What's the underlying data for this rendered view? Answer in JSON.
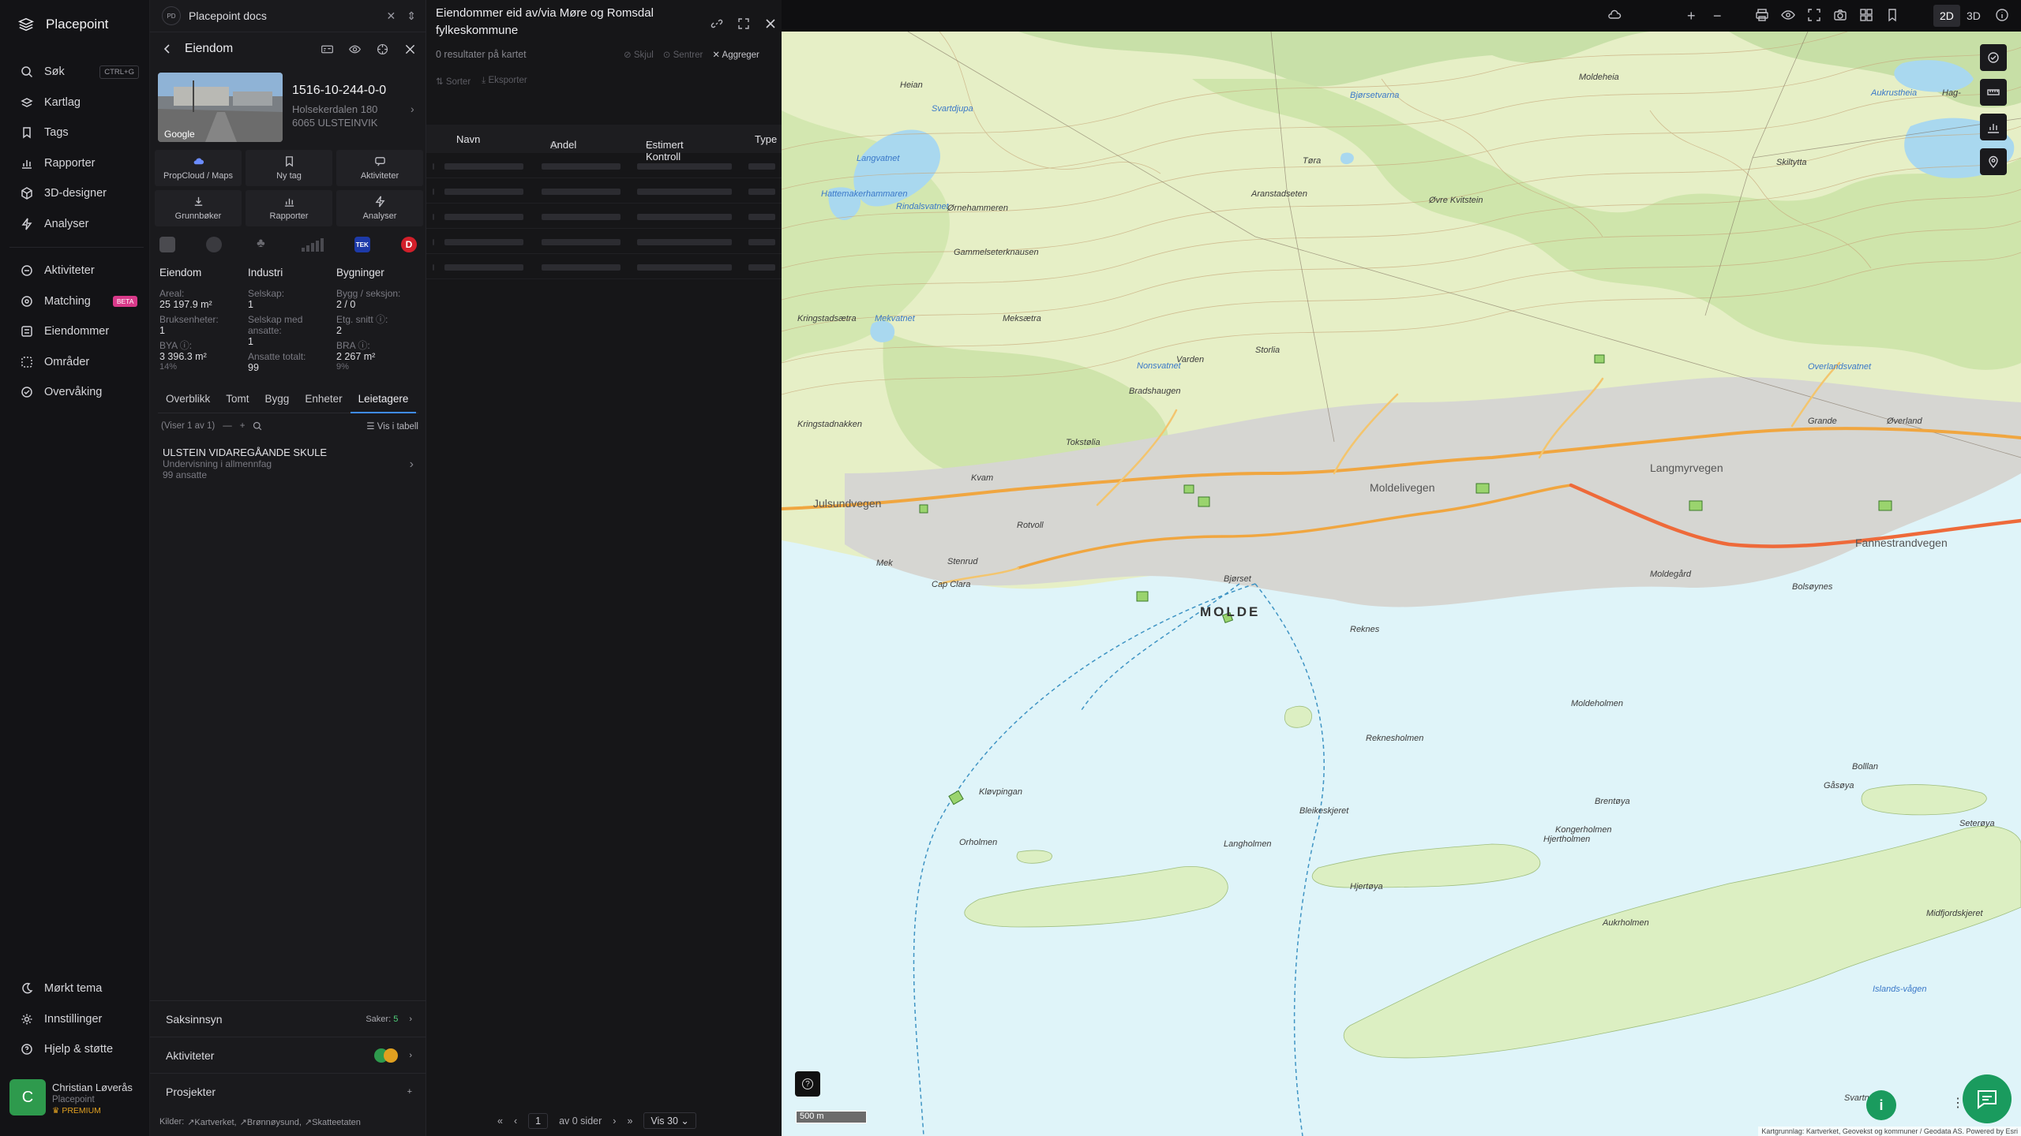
{
  "nav": {
    "brand": "Placepoint",
    "items": [
      {
        "label": "Søk",
        "icon": "search-icon",
        "kbd": "CTRL+G"
      },
      {
        "label": "Kartlag",
        "icon": "layers-icon"
      },
      {
        "label": "Tags",
        "icon": "bookmark-icon"
      },
      {
        "label": "Rapporter",
        "icon": "bar-chart-icon"
      },
      {
        "label": "3D-designer",
        "icon": "cube-icon"
      },
      {
        "label": "Analyser",
        "icon": "bolt-icon"
      }
    ],
    "items2": [
      {
        "label": "Aktiviteter",
        "icon": "chat-icon"
      },
      {
        "label": "Matching",
        "icon": "target-icon",
        "badge": "BETA"
      },
      {
        "label": "Eiendommer",
        "icon": "list-icon"
      },
      {
        "label": "Områder",
        "icon": "dashed-square-icon"
      },
      {
        "label": "Overvåking",
        "icon": "check-circle-icon"
      }
    ],
    "bottom": [
      {
        "label": "Mørkt tema",
        "icon": "moon-icon"
      },
      {
        "label": "Innstillinger",
        "icon": "gear-icon"
      },
      {
        "label": "Hjelp & støtte",
        "icon": "help-icon"
      }
    ],
    "user": {
      "initial": "C",
      "name": "Christian Løverås",
      "org": "Placepoint",
      "tier": "PREMIUM"
    }
  },
  "doc": {
    "badge": "PD",
    "title": "Placepoint docs"
  },
  "entity": {
    "title": "Eiendom",
    "photo_label": "Google",
    "id": "1516-10-244-0-0",
    "address1": "Holsekerdalen 180",
    "address2": "6065 ULSTEINVIK"
  },
  "actions": [
    "PropCloud / Maps",
    "Ny tag",
    "Aktiviteter",
    "Grunnbøker",
    "Rapporter",
    "Analyser"
  ],
  "sources": {
    "tek_label": "TEK",
    "d_label": "D"
  },
  "stats": {
    "eiendom": {
      "header": "Eiendom",
      "areal_label": "Areal:",
      "areal": "25 197.9 m²",
      "bruks_label": "Bruksenheter:",
      "bruks": "1",
      "bya_label": "BYA ⓘ:",
      "bya": "3 396.3 m²",
      "bya_pct": "14%"
    },
    "industri": {
      "header": "Industri",
      "selskap_label": "Selskap:",
      "selskap": "1",
      "ansatte_label": "Selskap med ansatte:",
      "ansatte": "1",
      "total_label": "Ansatte totalt:",
      "total": "99"
    },
    "bygninger": {
      "header": "Bygninger",
      "bygg_label": "Bygg / seksjon:",
      "bygg": "2 / 0",
      "etg_label": "Etg. snitt ⓘ:",
      "etg": "2",
      "bra_label": "BRA ⓘ:",
      "bra": "2 267 m²",
      "bra_pct": "9%"
    }
  },
  "tabs": [
    "Overblikk",
    "Tomt",
    "Bygg",
    "Enheter",
    "Leietagere"
  ],
  "subbar": {
    "showing": "(Viser 1 av 1)",
    "table": "Vis i tabell"
  },
  "tenant": {
    "name": "ULSTEIN VIDAREGÅANDE SKULE",
    "category": "Undervisning i allmennfag",
    "employees": "99 ansatte"
  },
  "accordions": {
    "saksinnsyn": "Saksinnsyn",
    "saker_label": "Saker:",
    "saker_count": "5",
    "aktiviteter": "Aktiviteter",
    "prosjekter": "Prosjekter"
  },
  "kilder": {
    "label": "Kilder:",
    "items": [
      "Kartverket,",
      "Brønnøysund,",
      "Skatteetaten"
    ]
  },
  "results": {
    "title": "Eiendommer eid av/via Møre og Romsdal fylkeskommune",
    "count": "0 resultater på kartet",
    "tools": [
      "Skjul",
      "Sentrer",
      "Aggreger"
    ],
    "tools2": [
      "Sorter",
      "Eksporter"
    ],
    "columns": [
      "Navn",
      "Andel",
      "Estimert Kontroll",
      "Type"
    ],
    "pager": {
      "page": "1",
      "of": "av 0 sider",
      "per": "Vis 30"
    }
  },
  "toolbar": {
    "north": "N",
    "plus": "+",
    "minus": "−",
    "mode2d": "2D",
    "mode3d": "3D"
  },
  "map": {
    "city": "MOLDE",
    "labels": [
      "Heian",
      "Svartdjupa",
      "Moldeheia",
      "Hag-",
      "Bjørsetvarna",
      "Aukrustheia",
      "Langvatnet",
      "Hattemakerhammaren",
      "Rindalsvatnet",
      "Tøra",
      "Øvre Kvitstein",
      "Skiltytta",
      "Ørnehammeren",
      "Varden",
      "Aranstadseten",
      "Gammelseterknausen",
      "Kringstadsætra",
      "Mekvatnet",
      "Meksætra",
      "Storlia",
      "Nonsvatnet",
      "Overlandsvatnet",
      "Bradshaugen",
      "Kringstadnakken",
      "Tokstølia",
      "Grande",
      "Øverland",
      "Kvam",
      "Julsundvegen",
      "Moldelivegen",
      "Langmyrvegen",
      "Fannestrandvegen",
      "Rotvoll",
      "Mek",
      "Stenrud",
      "Cap Clara",
      "Bjørset",
      "Moldegård",
      "Bolsøynes",
      "Reknes",
      "Moldeholmen",
      "Reknesholmen",
      "Kløvpingan",
      "Bleikeskjeret",
      "Kongerholmen",
      "Hjertholmen",
      "Brentøya",
      "Gåsøya",
      "Seterøya",
      "Orholmen",
      "Langholmen",
      "Hjertøya",
      "Aukrholmen",
      "Bolllan",
      "Midfjordskjeret",
      "Svartneset",
      "Islands-vågen"
    ],
    "scale": "500 m",
    "attribution": "Kartgrunnlag: Kartverket, Geovekst og kommuner / Geodata AS. Powered by Esri",
    "help": "?",
    "info": "i"
  }
}
